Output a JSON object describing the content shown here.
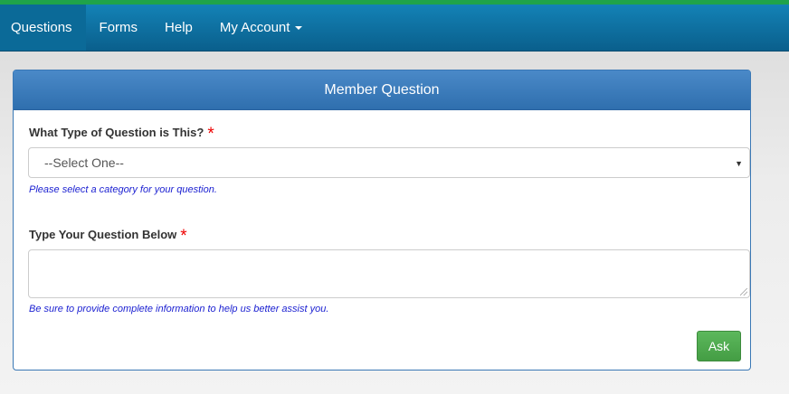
{
  "nav": {
    "items": [
      {
        "label": "Questions"
      },
      {
        "label": "Forms"
      },
      {
        "label": "Help"
      },
      {
        "label": "My Account"
      }
    ]
  },
  "panel": {
    "title": "Member Question",
    "question_type": {
      "label": "What Type of Question is This?",
      "required_mark": "*",
      "selected": "--Select One--",
      "help": "Please select a category for your question."
    },
    "question_text": {
      "label": "Type Your Question Below",
      "required_mark": "*",
      "value": "",
      "help": "Be sure to provide complete information to help us better assist you."
    },
    "submit_label": "Ask"
  },
  "colors": {
    "nav_bg": "#0a6a9c",
    "accent_green": "#5cb85c",
    "required": "#e00000",
    "help_text": "#1a1fd1"
  }
}
